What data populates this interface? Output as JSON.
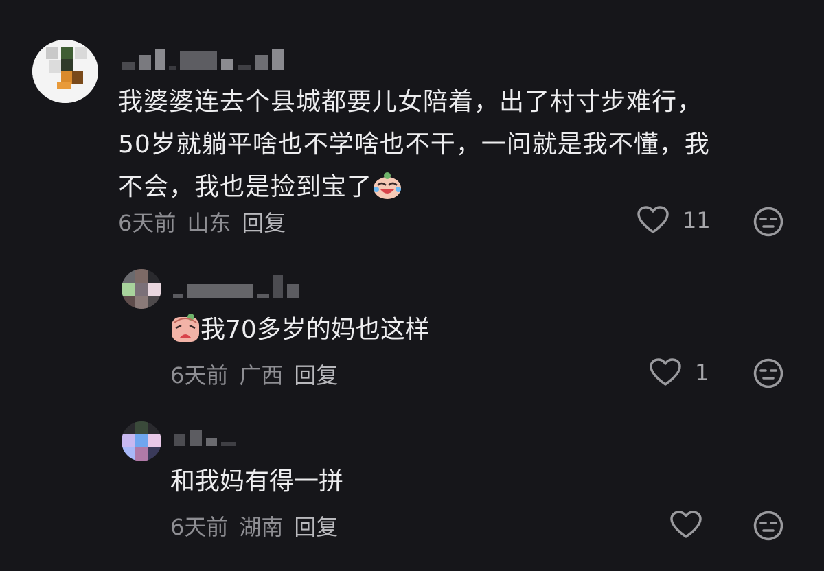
{
  "comments": [
    {
      "text_lines": [
        "我婆婆连去个县城都要儿女陪着，出了村寸步难行，",
        "50岁就躺平啥也不学啥也不干，一问就是我不懂，我",
        "不会，我也是捡到宝了"
      ],
      "emoji": "laughing-crying-emoji",
      "time": "6天前",
      "location": "山东",
      "reply_label": "回复",
      "likes": "11"
    }
  ],
  "replies": [
    {
      "emoji": "crying-emoji",
      "text": "我70多岁的妈也这样",
      "time": "6天前",
      "location": "广西",
      "reply_label": "回复",
      "likes": "1"
    },
    {
      "text": "和我妈有得一拼",
      "time": "6天前",
      "location": "湖南",
      "reply_label": "回复",
      "likes": ""
    }
  ],
  "colors": {
    "background": "#16161a",
    "text_primary": "#ededef",
    "text_secondary": "#8e8e93"
  },
  "icons": [
    "heart-outline-icon",
    "meh-face-icon"
  ]
}
